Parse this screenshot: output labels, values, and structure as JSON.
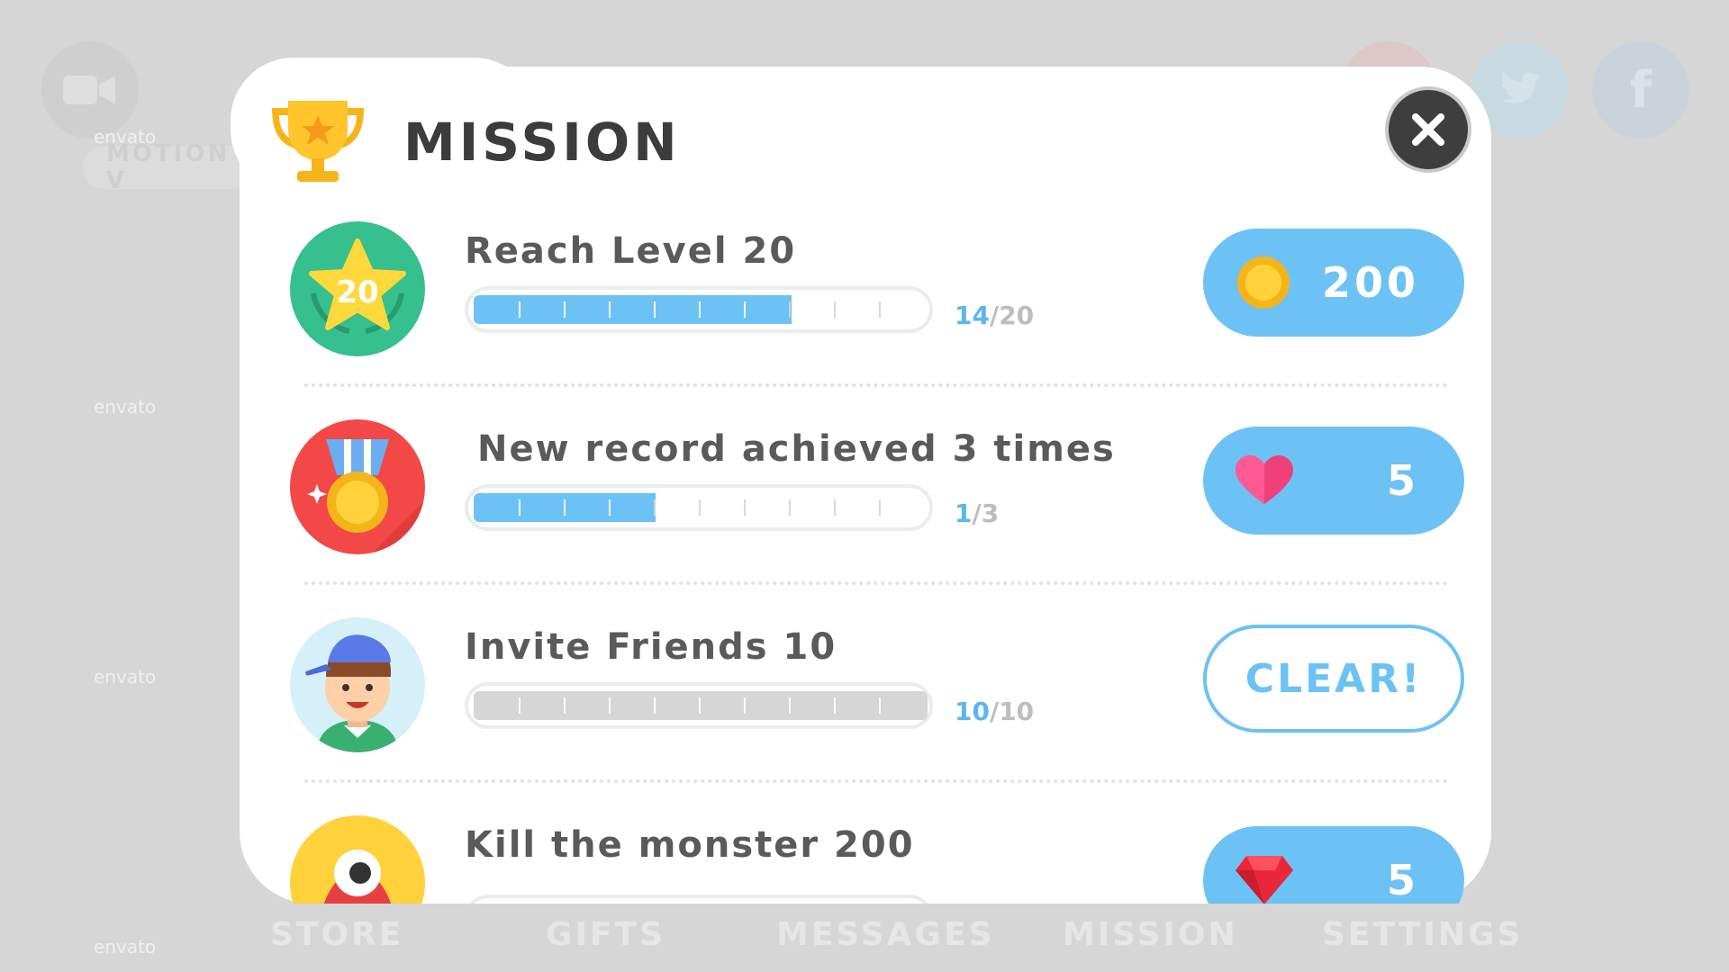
{
  "background": {
    "motion_label": "MOTION V",
    "bottom_nav": [
      "STORE",
      "GIFTS",
      "MESSAGES",
      "MISSION",
      "SETTINGS"
    ],
    "social_icons": [
      "video-camera-icon",
      "twitter-icon",
      "facebook-icon"
    ],
    "watermark": "envato"
  },
  "header": {
    "title": "MISSION",
    "icon": "trophy-icon"
  },
  "close_button": {
    "icon": "close-icon"
  },
  "missions": [
    {
      "title": "Reach Level 20",
      "avatar": "level-star-icon",
      "avatar_text": "20",
      "progress_done": "14",
      "progress_total": "/20",
      "progress_fraction": 0.7,
      "bar_color": "#6cc2f5",
      "reward_icon": "gold-coin-icon",
      "reward_amount": "200"
    },
    {
      "title": "New record achieved 3 times",
      "avatar": "medal-icon",
      "progress_done": "1",
      "progress_total": "/3",
      "progress_fraction": 0.4,
      "bar_color": "#6cc2f5",
      "reward_icon": "heart-icon",
      "reward_amount": "5"
    },
    {
      "title": "Invite Friends 10",
      "avatar": "boy-avatar-icon",
      "progress_done": "10",
      "progress_total": "/10",
      "progress_fraction": 1.0,
      "bar_color": "#d6d6d6",
      "reward_label": "CLEAR!"
    },
    {
      "title": "Kill the monster 200",
      "avatar": "monster-icon",
      "reward_icon": "ruby-gem-icon",
      "reward_amount": "5"
    }
  ],
  "colors": {
    "accent_blue": "#6cc2f5",
    "progress_text_blue": "#5cb6ee",
    "close_dark": "#3e3e3e",
    "title_gray": "#5a5a5a"
  }
}
